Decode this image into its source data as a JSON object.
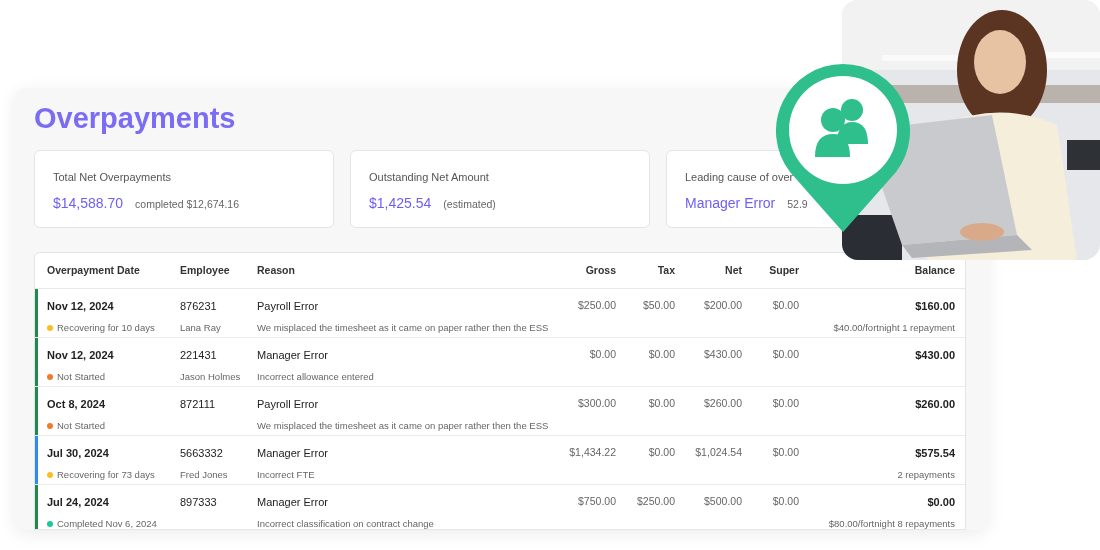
{
  "title": "Overpayments",
  "cards": [
    {
      "label": "Total Net Overpayments",
      "value": "$14,588.70",
      "note": "completed $12,674.16"
    },
    {
      "label": "Outstanding Net Amount",
      "value": "$1,425.54",
      "note": "(estimated)"
    },
    {
      "label": "Leading cause of over",
      "value": "Manager Error",
      "note": "52.9"
    }
  ],
  "table": {
    "columns": [
      "Overpayment Date",
      "Employee",
      "Reason",
      "Gross",
      "Tax",
      "Net",
      "Super",
      "Balance"
    ],
    "rows": [
      {
        "color": "#1f8a4c",
        "date": "Nov 12, 2024",
        "status": {
          "label": "Recovering for 10 days",
          "color": "#fbbf24"
        },
        "employee_id": "876231",
        "employee_name": "Lana Ray",
        "reason": "Payroll Error",
        "reason_detail": "We misplaced the timesheet as it came on paper rather then the ESS",
        "gross": "$250.00",
        "tax": "$50.00",
        "net": "$200.00",
        "super": "$0.00",
        "balance": "$160.00",
        "balance_note": "$40.00/fortnight 1 repayment"
      },
      {
        "color": "#1f8a4c",
        "date": "Nov 12, 2024",
        "status": {
          "label": "Not Started",
          "color": "#f07a2a"
        },
        "employee_id": "221431",
        "employee_name": "Jason Holmes",
        "reason": "Manager Error",
        "reason_detail": "Incorrect allowance entered",
        "gross": "$0.00",
        "tax": "$0.00",
        "net": "$430.00",
        "super": "$0.00",
        "balance": "$430.00"
      },
      {
        "color": "#1f8a4c",
        "date": "Oct 8, 2024",
        "status": {
          "label": "Not Started",
          "color": "#f07a2a"
        },
        "employee_id": "872111",
        "reason": "Payroll Error",
        "reason_detail": "We misplaced the timesheet as it came on paper rather then the ESS",
        "gross": "$300.00",
        "tax": "$0.00",
        "net": "$260.00",
        "super": "$0.00",
        "balance": "$260.00"
      },
      {
        "color": "#2b8cf0",
        "date": "Jul 30, 2024",
        "status": {
          "label": "Recovering for 73 days",
          "color": "#fbbf24"
        },
        "employee_id": "5663332",
        "employee_name": "Fred Jones",
        "reason": "Manager Error",
        "reason_detail": "Incorrect FTE",
        "gross": "$1,434.22",
        "tax": "$0.00",
        "net": "$1,024.54",
        "super": "$0.00",
        "balance": "$575.54",
        "balance_note": "2 repayments"
      },
      {
        "color": "#1f8a4c",
        "date": "Jul 24, 2024",
        "status": {
          "label": "Completed Nov 6, 2024",
          "color": "#19c99a"
        },
        "employee_id": "897333",
        "reason": "Manager Error",
        "reason_detail": "Incorrect classification on contract change",
        "gross": "$750.00",
        "tax": "$250.00",
        "net": "$500.00",
        "super": "$0.00",
        "balance": "$0.00",
        "balance_note": "$80.00/fortnight 8 repayments"
      }
    ]
  }
}
